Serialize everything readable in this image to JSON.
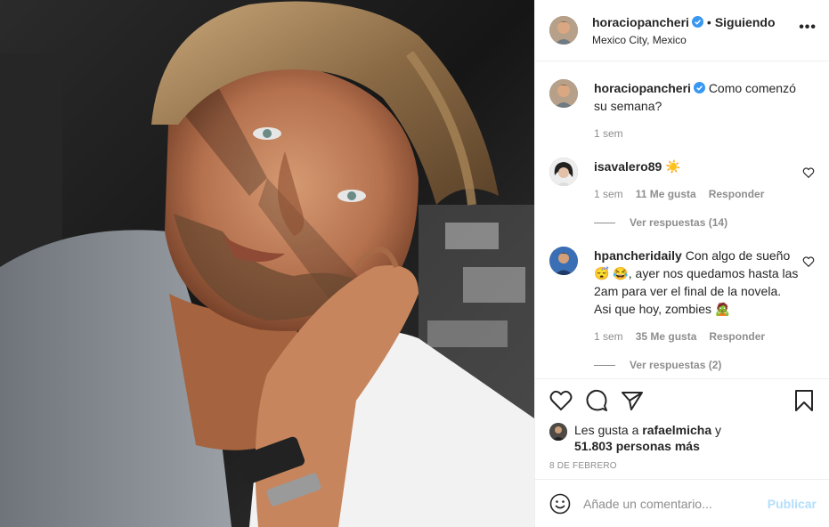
{
  "post": {
    "username": "horaciopancheri",
    "follow_state": "Siguiendo",
    "separator": "•",
    "location": "Mexico City, Mexico",
    "more_label": "•••",
    "caption": "Como comenzó su semana?",
    "caption_time": "1 sem",
    "photo_icon": "portrait-photo"
  },
  "comments": [
    {
      "username": "isavalero89",
      "text": "☀️",
      "time": "1 sem",
      "likes": "11 Me gusta",
      "reply_label": "Responder",
      "view_replies": "Ver respuestas (14)"
    },
    {
      "username": "hpancheridaily",
      "text": "Con algo de sueño 😴 😂, ayer nos quedamos hasta las 2am para ver el final de la novela. Asi que hoy, zombies 🧟",
      "time": "1 sem",
      "likes": "35 Me gusta",
      "reply_label": "Responder",
      "view_replies": "Ver respuestas (2)"
    }
  ],
  "likes": {
    "prefix": "Les gusta a",
    "user": "rafaelmicha",
    "joiner": "y",
    "count": "51.803 personas más"
  },
  "date": "8 DE FEBRERO",
  "add_comment": {
    "placeholder": "Añade un comentario...",
    "publish": "Publicar"
  },
  "colors": {
    "verified": "#3897f0",
    "muted": "#8e8e8e",
    "publish_disabled": "#b2dffc"
  }
}
